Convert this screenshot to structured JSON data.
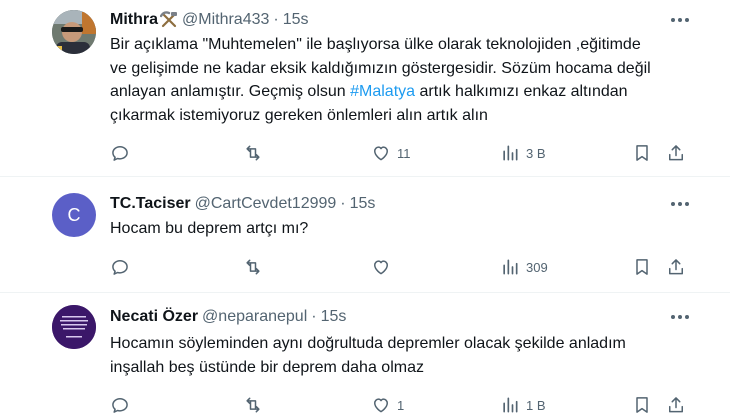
{
  "tweets": [
    {
      "name": "Mithra",
      "badge_icon": "pickaxe-hammer-icon",
      "handle": "@Mithra433",
      "time": "15s",
      "body_lines": [
        {
          "text": "Bir açıklama \"Muhtemelen\" ile başlıyorsa ülke olarak teknolojiden ,eğitimde"
        },
        {
          "text": "ve gelişimde ne kadar eksik kaldığımızın göstergesidir. Sözüm hocama değil"
        },
        {
          "text": "anlayan anlamıştır. Geçmiş olsun ",
          "hashtag": "#Malatya",
          "after": " artık halkımızı enkaz altından"
        },
        {
          "text": "çıkarmak istemiyoruz gereken önlemleri alın artık alın"
        }
      ],
      "likes": "11",
      "views": "3 B"
    },
    {
      "name": "TC.Taciser",
      "avatar_letter": "C",
      "avatar_color": "#5b5fc7",
      "handle": "@CartCevdet12999",
      "time": "15s",
      "body_lines": [
        {
          "text": "Hocam bu deprem artçı mı?"
        }
      ],
      "likes": "",
      "views": "309"
    },
    {
      "name": "Necati Özer",
      "avatar_color": "#3b1769",
      "handle": "@neparanepul",
      "time": "15s",
      "body_lines": [
        {
          "text": "Hocamın söyleminden aynı doğrultuda depremler olacak şekilde anladım"
        },
        {
          "text": "inşallah beş üstünde bir deprem daha olmaz"
        }
      ],
      "likes": "1",
      "views": "1 B"
    }
  ],
  "separator": "·",
  "colors": {
    "text": "#0f1419",
    "muted": "#536471",
    "link": "#1d9bf0",
    "divider": "#eff3f4"
  }
}
